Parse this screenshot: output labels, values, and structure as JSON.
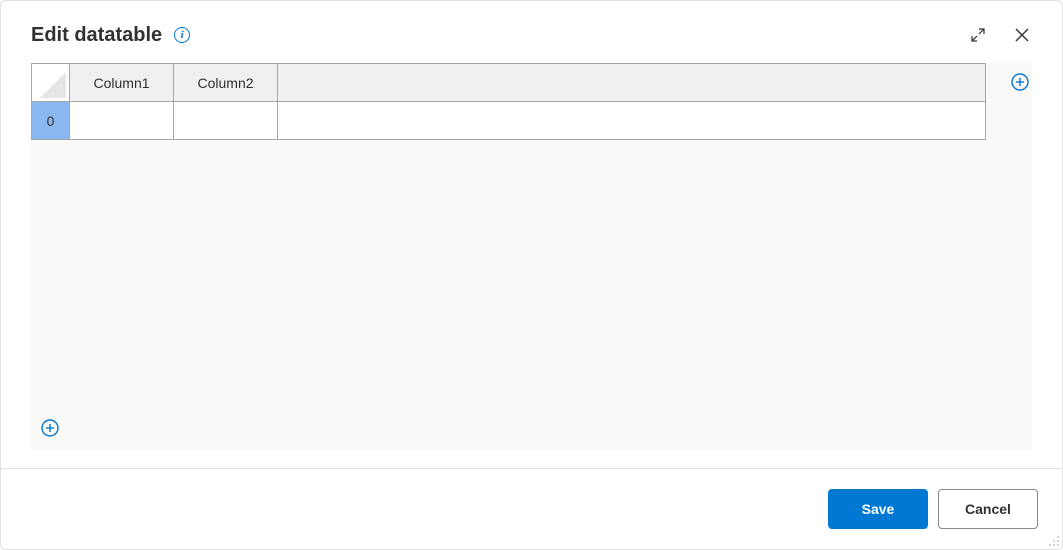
{
  "dialog": {
    "title": "Edit datatable"
  },
  "table": {
    "columns": [
      "Column1",
      "Column2",
      ""
    ],
    "rows": [
      {
        "index": "0",
        "cells": [
          "",
          "",
          ""
        ]
      }
    ]
  },
  "buttons": {
    "save": "Save",
    "cancel": "Cancel"
  },
  "colors": {
    "accent": "#0078d4",
    "row_header_bg": "#8bb7f0"
  }
}
